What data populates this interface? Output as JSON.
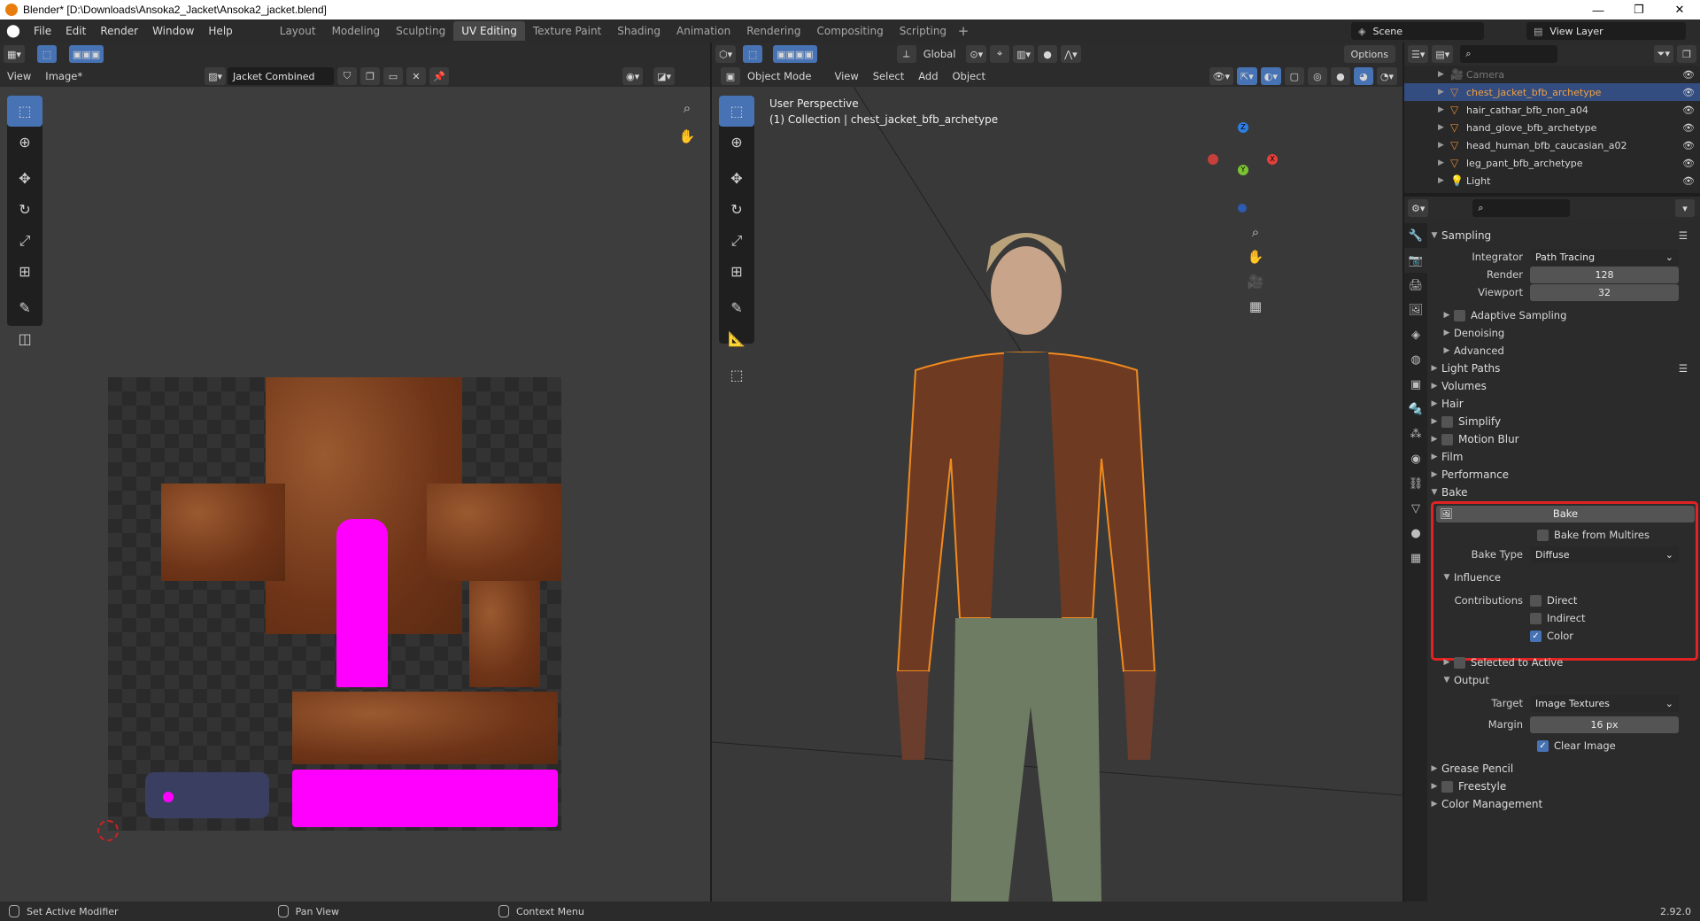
{
  "window": {
    "title": "Blender* [D:\\Downloads\\Ansoka2_Jacket\\Ansoka2_jacket.blend]",
    "minimize": "—",
    "maximize": "❐",
    "close": "✕"
  },
  "menu": [
    "File",
    "Edit",
    "Render",
    "Window",
    "Help"
  ],
  "workspaces": [
    {
      "label": "Layout",
      "active": false
    },
    {
      "label": "Modeling",
      "active": false
    },
    {
      "label": "Sculpting",
      "active": false
    },
    {
      "label": "UV Editing",
      "active": true
    },
    {
      "label": "Texture Paint",
      "active": false
    },
    {
      "label": "Shading",
      "active": false
    },
    {
      "label": "Animation",
      "active": false
    },
    {
      "label": "Rendering",
      "active": false
    },
    {
      "label": "Compositing",
      "active": false
    },
    {
      "label": "Scripting",
      "active": false
    }
  ],
  "workspace_add": "+",
  "scene": {
    "name": "Scene",
    "view_layer": "View Layer"
  },
  "uv_editor": {
    "menu_view": "View",
    "menu_image": "Image*",
    "image_name": "Jacket Combined"
  },
  "viewport": {
    "options": "Options",
    "orientation": "Global",
    "mode": "Object Mode",
    "menus": [
      "View",
      "Select",
      "Add",
      "Object"
    ],
    "info_line1": "User Perspective",
    "info_line2": "(1) Collection | chest_jacket_bfb_archetype",
    "gizmo": {
      "z": "Z",
      "x": "X",
      "y": "Y"
    }
  },
  "outliner": {
    "rows": [
      {
        "name": "Camera",
        "selected": false,
        "dim": true,
        "icon": "camera-icon"
      },
      {
        "name": "chest_jacket_bfb_archetype",
        "selected": true,
        "dim": false,
        "icon": "mesh-icon"
      },
      {
        "name": "hair_cathar_bfb_non_a04",
        "selected": false,
        "dim": false,
        "icon": "mesh-icon"
      },
      {
        "name": "hand_glove_bfb_archetype",
        "selected": false,
        "dim": false,
        "icon": "mesh-icon"
      },
      {
        "name": "head_human_bfb_caucasian_a02",
        "selected": false,
        "dim": false,
        "icon": "mesh-icon"
      },
      {
        "name": "leg_pant_bfb_archetype",
        "selected": false,
        "dim": false,
        "icon": "mesh-icon"
      },
      {
        "name": "Light",
        "selected": false,
        "dim": false,
        "icon": "light-icon"
      }
    ]
  },
  "properties": {
    "sampling": {
      "title": "Sampling",
      "integrator_label": "Integrator",
      "integrator_value": "Path Tracing",
      "render_label": "Render",
      "render_value": "128",
      "viewport_label": "Viewport",
      "viewport_value": "32",
      "adaptive": "Adaptive Sampling",
      "denoising": "Denoising",
      "advanced": "Advanced"
    },
    "panels": [
      "Light Paths",
      "Volumes",
      "Hair",
      "Simplify",
      "Motion Blur",
      "Film",
      "Performance"
    ],
    "bake": {
      "title": "Bake",
      "button": "Bake",
      "from_multires": "Bake from Multires",
      "bake_type_label": "Bake Type",
      "bake_type_value": "Diffuse",
      "influence": "Influence",
      "contributions": "Contributions",
      "direct": "Direct",
      "indirect": "Indirect",
      "color": "Color",
      "color_checked": true,
      "selected_to_active": "Selected to Active",
      "output": "Output",
      "target_label": "Target",
      "target_value": "Image Textures",
      "margin_label": "Margin",
      "margin_value": "16 px",
      "clear_image": "Clear Image",
      "clear_checked": true
    },
    "bottom_panels": [
      "Grease Pencil",
      "Freestyle",
      "Color Management"
    ]
  },
  "statusbar": {
    "left": "Set Active Modifier",
    "middle": "Pan View",
    "right": "Context Menu",
    "version": "2.92.0"
  }
}
